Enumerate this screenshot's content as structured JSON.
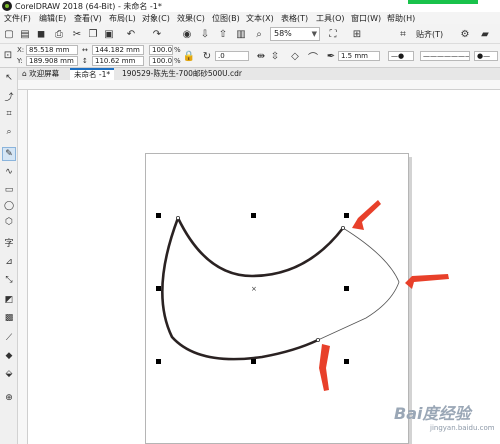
{
  "window": {
    "title": "CorelDRAW 2018 (64-Bit) - 未命名 -1*"
  },
  "menu": [
    {
      "label": "文件(F)"
    },
    {
      "label": "编辑(E)"
    },
    {
      "label": "查看(V)"
    },
    {
      "label": "布局(L)"
    },
    {
      "label": "对象(C)"
    },
    {
      "label": "效果(C)"
    },
    {
      "label": "位图(B)"
    },
    {
      "label": "文本(X)"
    },
    {
      "label": "表格(T)"
    },
    {
      "label": "工具(O)"
    },
    {
      "label": "窗口(W)"
    },
    {
      "label": "帮助(H)"
    }
  ],
  "toolbar": {
    "zoom_value": "58%",
    "snap_label": "贴齐(T)",
    "icons": [
      "new-icon",
      "open-icon",
      "save-icon",
      "print-icon",
      "cut-icon",
      "copy-icon",
      "paste-icon",
      "undo-icon",
      "redo-icon",
      "search-icon",
      "import-icon",
      "export-icon",
      "pdf-icon",
      "zoom-icon",
      "fullscreen-icon",
      "rulers-icon",
      "gear-icon"
    ]
  },
  "properties": {
    "x_label": "X:",
    "x_value": "85.518 mm",
    "y_label": "Y:",
    "y_value": "189.908 mm",
    "w_value": "144.182 mm",
    "h_value": "110.62 mm",
    "scale_w": "100.0",
    "scale_h": "100.0",
    "percent": "%",
    "rotation": ".0",
    "outline_width": "1.5 mm"
  },
  "tabs": [
    {
      "label": "欢迎屏幕"
    },
    {
      "label": "未命名 -1*"
    },
    {
      "label": "190529-陈先生-700邮砂500U.cdr"
    }
  ],
  "tools": [
    "pick-tool-icon",
    "freehand-pick-icon",
    "crop-icon",
    "zoom-icon",
    "freehand-icon",
    "artistic-media-icon",
    "rectangle-icon",
    "ellipse-icon",
    "polygon-icon",
    "text-icon",
    "parallel-dimension-icon",
    "connector-icon",
    "drop-shadow-icon",
    "transparency-icon",
    "eyedropper-icon",
    "interactive-fill-icon",
    "smart-fill-icon",
    "add-icon"
  ],
  "watermark": {
    "text": "Bai度经验",
    "url": "jingyan.baidu.com"
  },
  "colors": {
    "accent": "#1c6fc2",
    "arrow": "#e8402a",
    "logo": "#7cbb2a"
  }
}
